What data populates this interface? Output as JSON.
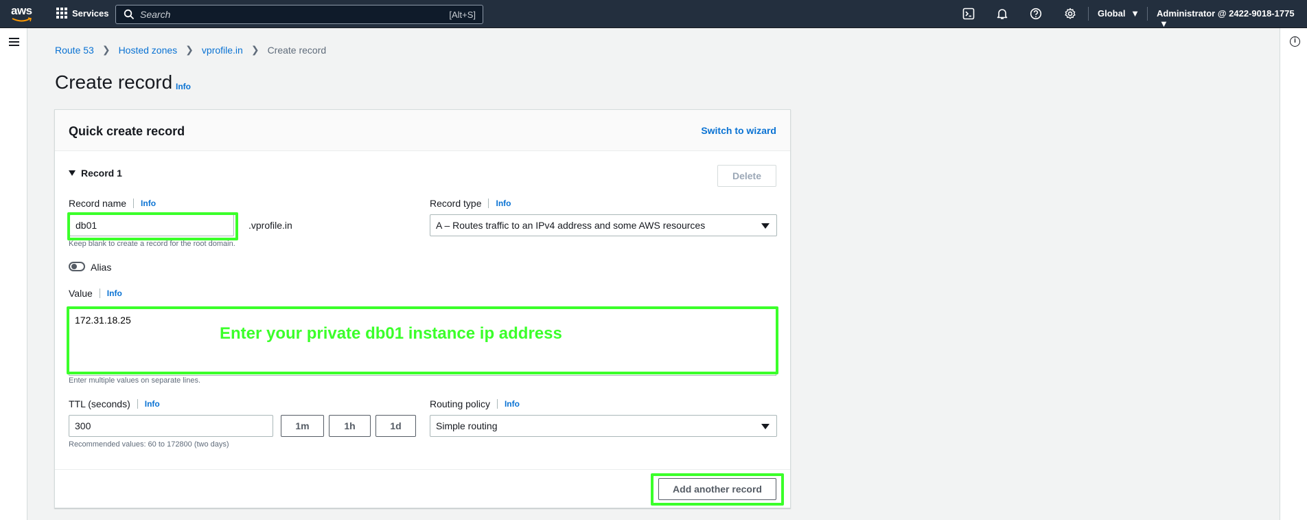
{
  "topnav": {
    "logo_text": "aws",
    "services_label": "Services",
    "search_placeholder": "Search",
    "search_shortcut": "[Alt+S]",
    "region": "Global",
    "account": "Administrator @ 2422-9018-1775",
    "bg_color": "#232f3e"
  },
  "breadcrumb": {
    "items": [
      "Route 53",
      "Hosted zones",
      "vprofile.in"
    ],
    "current": "Create record"
  },
  "page": {
    "title": "Create record",
    "info": "Info"
  },
  "panel": {
    "title": "Quick create record",
    "switch_wizard": "Switch to wizard",
    "record_header": "Record 1",
    "delete_label": "Delete",
    "record_name": {
      "label": "Record name",
      "info": "Info",
      "value": "db01",
      "suffix": ".vprofile.in",
      "hint": "Keep blank to create a record for the root domain."
    },
    "record_type": {
      "label": "Record type",
      "info": "Info",
      "value": "A – Routes traffic to an IPv4 address and some AWS resources"
    },
    "alias_label": "Alias",
    "value_field": {
      "label": "Value",
      "info": "Info",
      "value": "172.31.18.25",
      "hint": "Enter multiple values on separate lines.",
      "overlay_annotation": "Enter your private db01 instance ip address"
    },
    "ttl": {
      "label": "TTL (seconds)",
      "info": "Info",
      "value": "300",
      "presets": [
        "1m",
        "1h",
        "1d"
      ],
      "hint": "Recommended values: 60 to 172800 (two days)"
    },
    "routing_policy": {
      "label": "Routing policy",
      "info": "Info",
      "value": "Simple routing"
    },
    "add_another_label": "Add another record"
  },
  "colors": {
    "link": "#0972d3",
    "highlight": "#3bff2a"
  }
}
